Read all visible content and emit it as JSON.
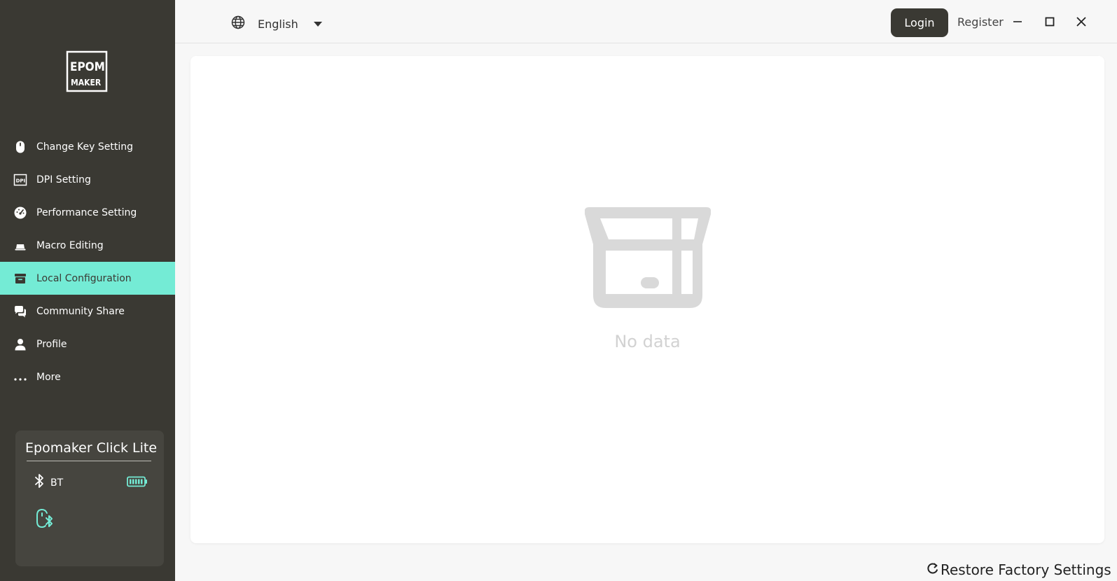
{
  "app": {
    "logo_text_top": "EPOM",
    "logo_text_bottom": "MAKER"
  },
  "sidebar": {
    "items": [
      {
        "label": "Change Key Setting",
        "icon": "mouse-icon",
        "active": false
      },
      {
        "label": "DPI Setting",
        "icon": "dpi-icon",
        "active": false
      },
      {
        "label": "Performance Setting",
        "icon": "speedometer-icon",
        "active": false
      },
      {
        "label": "Macro Editing",
        "icon": "laptop-icon",
        "active": false
      },
      {
        "label": "Local Configuration",
        "icon": "archive-icon",
        "active": true
      },
      {
        "label": "Community Share",
        "icon": "chat-icon",
        "active": false
      },
      {
        "label": "Profile",
        "icon": "user-icon",
        "active": false
      },
      {
        "label": "More",
        "icon": "ellipsis-icon",
        "active": false
      }
    ]
  },
  "device": {
    "name": "Epomaker Click Lite",
    "connection": "BT",
    "battery_icon": "battery-full-icon"
  },
  "topbar": {
    "language": "English",
    "login_label": "Login",
    "register_label": "Register"
  },
  "main": {
    "empty_text": "No data"
  },
  "footer": {
    "restore_label": "Restore Factory Settings"
  },
  "colors": {
    "sidebar_bg": "#3a3933",
    "accent": "#74ebd5",
    "card_bg": "#46453f"
  }
}
